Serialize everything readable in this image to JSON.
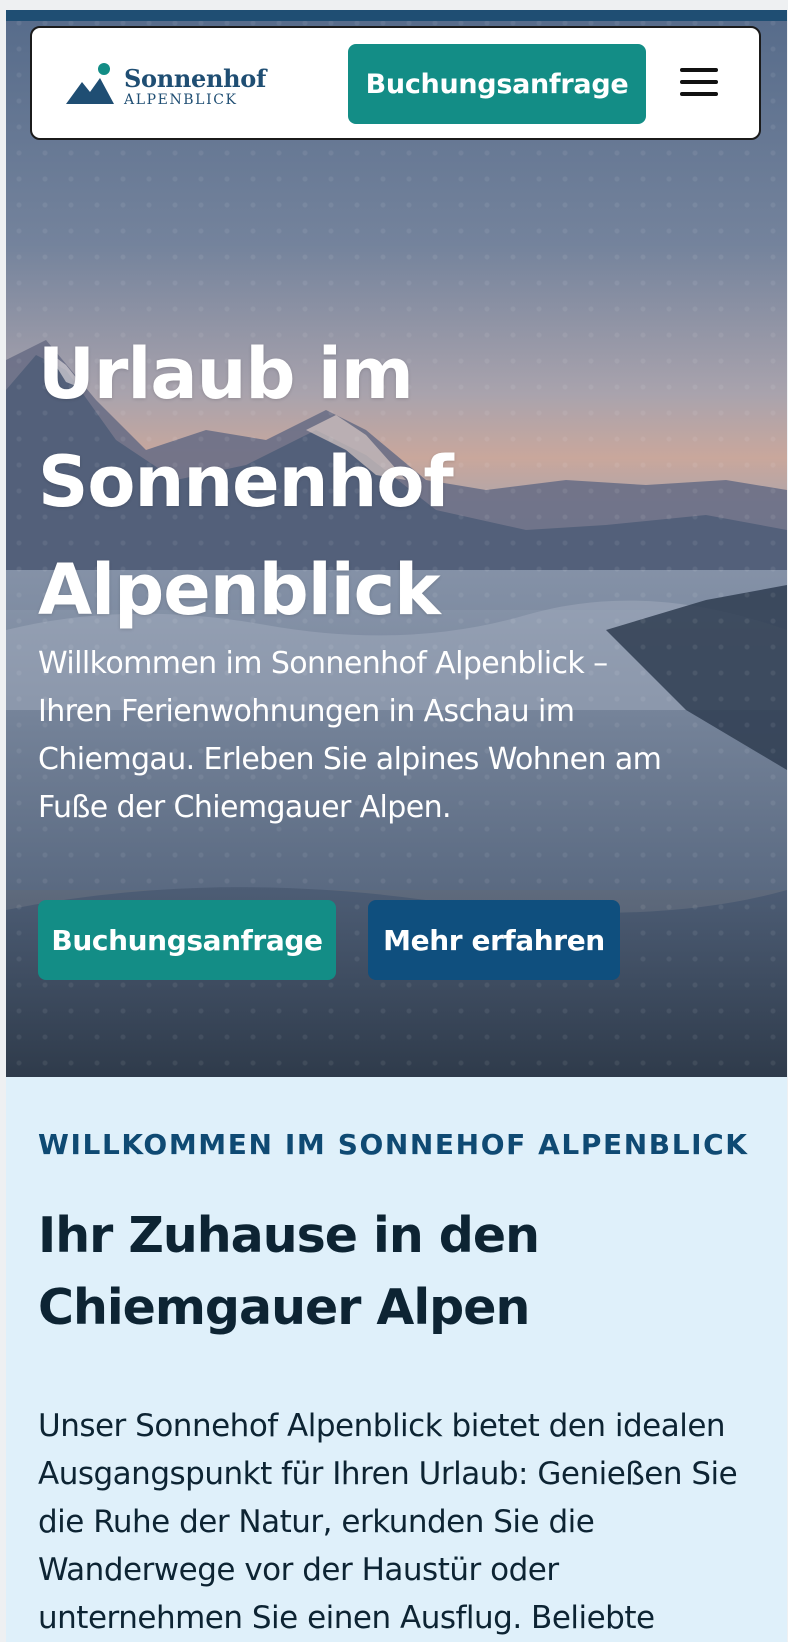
{
  "brand": {
    "name": "Sonnenhof",
    "subtitle": "ALPENBLICK"
  },
  "nav": {
    "cta_label": "Buchungsanfrage",
    "menu_icon": "hamburger-menu-icon"
  },
  "hero": {
    "title": "Urlaub im Sonnenhof Alpenblick",
    "lead": "Willkommen im Sonnenhof Alpenblick – Ihren Ferienwohnungen in Aschau im Chiemgau. Erleben Sie alpines Wohnen am Fuße der Chiemgauer Alpen.",
    "primary_button": "Buchungsanfrage",
    "secondary_button": "Mehr erfahren"
  },
  "welcome": {
    "kicker": "WILLKOMMEN IM SONNEHOF ALPENBLICK",
    "title": "Ihr Zuhause in den Chiemgauer Alpen",
    "body": "Unser Sonnehof Alpenblick bietet den idealen Ausgangspunkt für Ihren Urlaub: Genießen Sie die Ruhe der Natur, erkunden Sie die Wanderwege vor der Haustür oder unternehmen Sie einen Ausflug. Beliebte"
  },
  "colors": {
    "brand_teal": "#138d86",
    "brand_navy": "#0f4f7e",
    "section_bg": "#dff0fa",
    "heading_text": "#0d2433"
  }
}
